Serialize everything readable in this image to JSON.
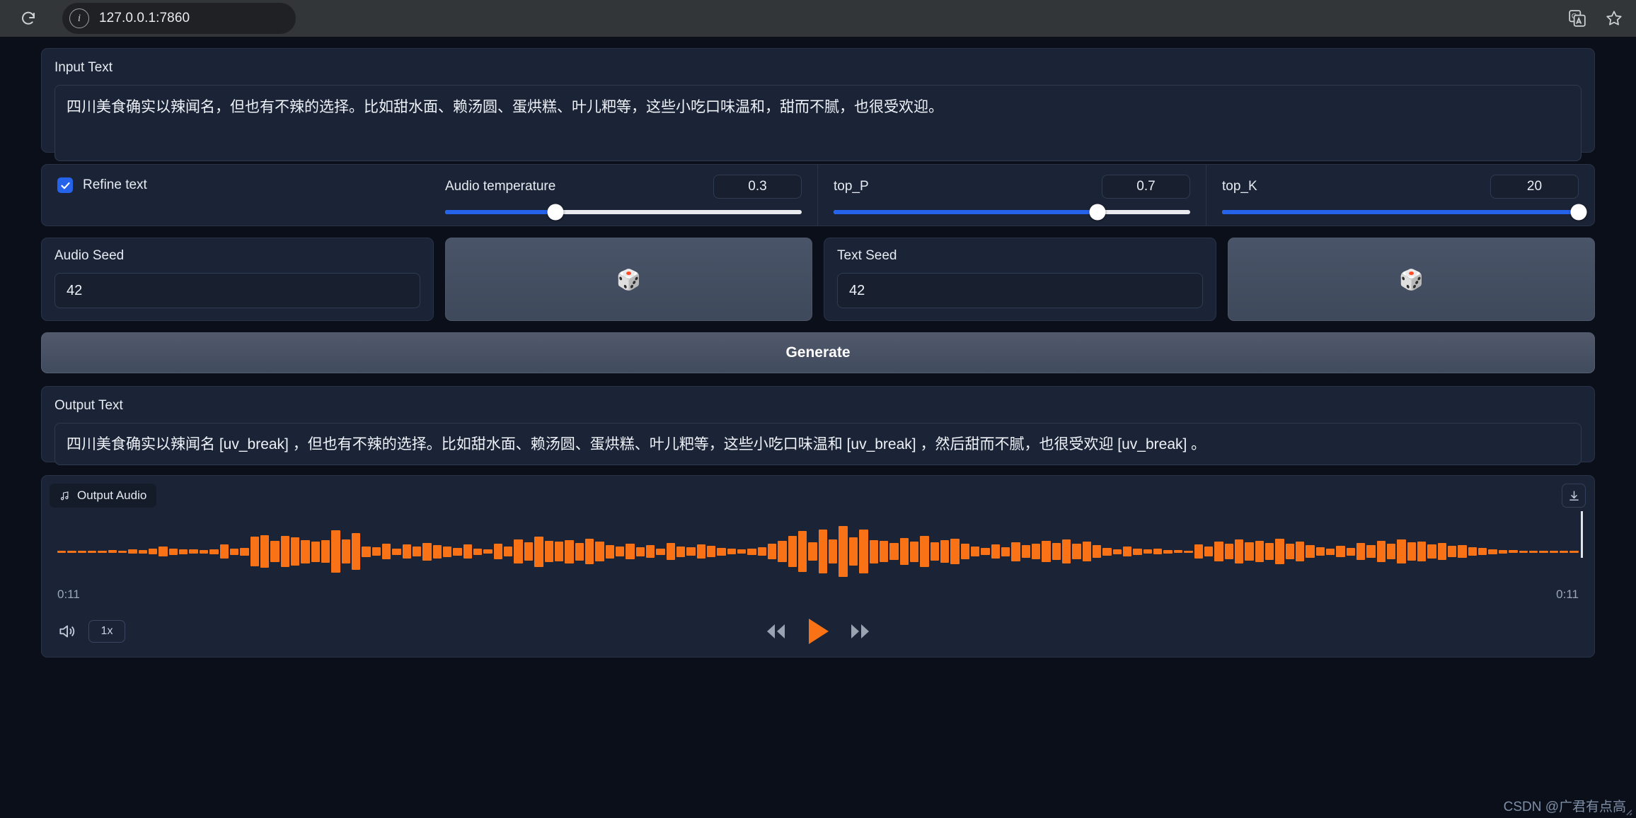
{
  "browser": {
    "url": "127.0.0.1:7860",
    "reload_icon": "reload-icon",
    "info_icon": "info-icon",
    "translate_icon": "translate-icon",
    "bookmark_icon": "star-icon"
  },
  "input_text": {
    "label": "Input Text",
    "value": "四川美食确实以辣闻名，但也有不辣的选择。比如甜水面、赖汤圆、蛋烘糕、叶儿粑等，这些小吃口味温和，甜而不腻，也很受欢迎。"
  },
  "controls": {
    "refine": {
      "label": "Refine text",
      "checked": true
    },
    "sliders": [
      {
        "label": "Audio temperature",
        "value": "0.3",
        "percent": 31
      },
      {
        "label": "top_P",
        "value": "0.7",
        "percent": 74
      },
      {
        "label": "top_K",
        "value": "20",
        "percent": 100
      }
    ]
  },
  "seeds": [
    {
      "label": "Audio Seed",
      "value": "42"
    },
    {
      "label": "Text Seed",
      "value": "42"
    }
  ],
  "dice": {
    "glyph": "🎲",
    "name": "dice-button"
  },
  "generate": {
    "label": "Generate"
  },
  "output_text": {
    "label": "Output Text",
    "value": "四川美食确实以辣闻名 [uv_break] ，但也有不辣的选择。比如甜水面、赖汤圆、蛋烘糕、叶儿粑等，这些小吃口味温和 [uv_break] ，然后甜而不腻，也很受欢迎 [uv_break] 。"
  },
  "audio": {
    "tab_label": "Output Audio",
    "music_icon": "music-note-icon",
    "download_icon": "download-icon",
    "time_current": "0:11",
    "time_total": "0:11",
    "speed": "1x",
    "volume_icon": "volume-icon",
    "rewind_icon": "rewind-icon",
    "play_icon": "play-icon",
    "forward_icon": "fast-forward-icon",
    "waveform_color": "#f97316",
    "waveform": [
      3,
      2,
      3,
      2,
      3,
      4,
      3,
      6,
      5,
      8,
      14,
      9,
      7,
      6,
      5,
      7,
      20,
      9,
      11,
      42,
      46,
      30,
      44,
      40,
      33,
      29,
      32,
      60,
      34,
      52,
      15,
      12,
      22,
      9,
      20,
      14,
      25,
      19,
      15,
      11,
      20,
      9,
      6,
      22,
      14,
      34,
      26,
      43,
      30,
      28,
      33,
      25,
      36,
      28,
      19,
      14,
      22,
      13,
      18,
      9,
      24,
      15,
      12,
      20,
      16,
      11,
      8,
      6,
      9,
      12,
      22,
      30,
      44,
      58,
      26,
      62,
      34,
      72,
      40,
      62,
      33,
      30,
      24,
      38,
      29,
      44,
      26,
      32,
      36,
      22,
      14,
      10,
      20,
      13,
      27,
      18,
      22,
      30,
      24,
      34,
      22,
      28,
      18,
      11,
      7,
      14,
      9,
      6,
      8,
      5,
      4,
      3,
      20,
      14,
      28,
      22,
      34,
      26,
      30,
      24,
      36,
      22,
      28,
      18,
      12,
      9,
      16,
      11,
      24,
      18,
      30,
      22,
      34,
      26,
      28,
      20,
      24,
      16,
      18,
      12,
      10,
      7,
      5,
      4,
      3,
      2,
      3,
      2,
      3,
      2
    ]
  },
  "watermark": "CSDN @广君有点高"
}
